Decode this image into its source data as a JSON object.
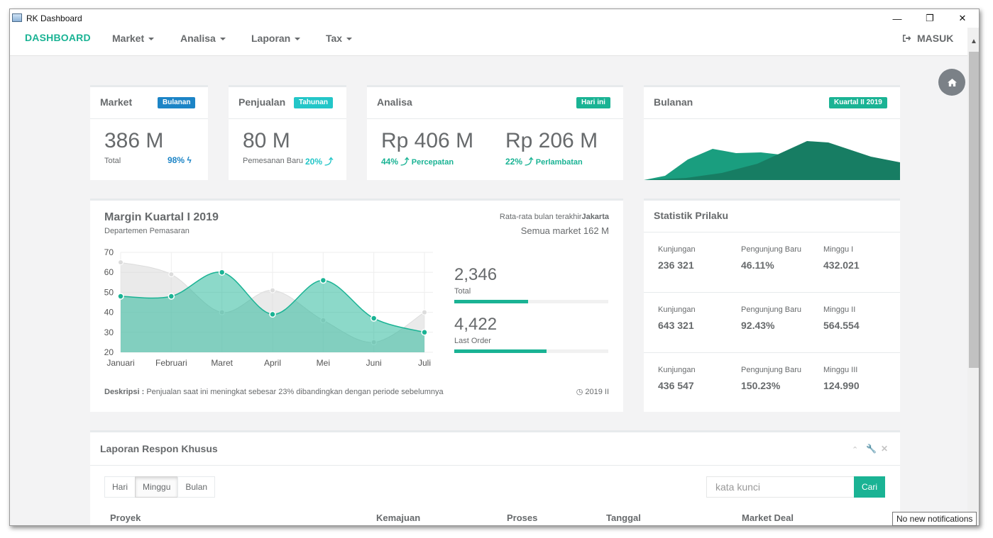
{
  "window": {
    "title": "RK Dashboard",
    "minimize": "—",
    "restore": "❐",
    "close": "✕"
  },
  "navbar": {
    "brand": "DASHBOARD",
    "menus": [
      "Market",
      "Analisa",
      "Laporan",
      "Tax"
    ],
    "login": "MASUK"
  },
  "cards": {
    "market": {
      "title": "Market",
      "badge": "Bulanan",
      "value": "386 M",
      "sub": "Total",
      "pct": "98%"
    },
    "penjualan": {
      "title": "Penjualan",
      "badge": "Tahunan",
      "value": "80 M",
      "sub": "Pemesanan Baru",
      "pct": "20%"
    },
    "analisa": {
      "title": "Analisa",
      "badge": "Hari ini",
      "v1": "Rp 406 M",
      "p1": "44%",
      "l1": "Percepatan",
      "v2": "Rp 206 M",
      "p2": "22%",
      "l2": "Perlambatan"
    },
    "bulanan": {
      "title": "Bulanan",
      "badge": "Kuartal II 2019"
    }
  },
  "margin": {
    "title": "Margin Kuartal I 2019",
    "subtitle": "Departemen Pemasaran",
    "avg_label": "Rata-rata bulan terakhir",
    "avg_city": "Jakarta",
    "avg_value": "Semua market 162 M",
    "stat1_value": "2,346",
    "stat1_label": "Total",
    "stat1_progress": 0.48,
    "stat2_value": "4,422",
    "stat2_label": "Last Order",
    "stat2_progress": 0.6,
    "desc_label": "Deskripsi :",
    "desc_text": "Penjualan saat ini meningkat sebesar 23% dibandingkan dengan periode sebelumnya",
    "period": "2019 II"
  },
  "chart_data": {
    "type": "area",
    "categories": [
      "Januari",
      "Februari",
      "Maret",
      "April",
      "Mei",
      "Juni",
      "Juli"
    ],
    "ylim": [
      20,
      70
    ],
    "yticks": [
      20,
      30,
      40,
      50,
      60,
      70
    ],
    "series": [
      {
        "values": [
          65,
          59,
          40,
          51,
          36,
          25,
          40
        ],
        "color": "#d8d8d8"
      },
      {
        "values": [
          48,
          48,
          60,
          39,
          56,
          37,
          30
        ],
        "color": "#1ab394"
      }
    ],
    "grid": true
  },
  "statistik": {
    "title": "Statistik Prilaku",
    "rows": [
      {
        "k1": "Kunjungan",
        "v1": "236 321",
        "k2": "Pengunjung Baru",
        "v2": "46.11%",
        "k3": "Minggu I",
        "v3": "432.021"
      },
      {
        "k1": "Kunjungan",
        "v1": "643 321",
        "k2": "Pengunjung Baru",
        "v2": "92.43%",
        "k3": "Minggu II",
        "v3": "564.554"
      },
      {
        "k1": "Kunjungan",
        "v1": "436 547",
        "k2": "Pengunjung Baru",
        "v2": "150.23%",
        "k3": "Minggu III",
        "v3": "124.990"
      }
    ]
  },
  "laporan": {
    "title": "Laporan Respon Khusus",
    "periods": [
      "Hari",
      "Minggu",
      "Bulan"
    ],
    "active_period": "Minggu",
    "search_placeholder": "kata kunci",
    "search_button": "Cari",
    "columns": [
      "Proyek",
      "Kemajuan",
      "Proses",
      "Tanggal",
      "Market Deal"
    ]
  },
  "notification": "No new notifications"
}
